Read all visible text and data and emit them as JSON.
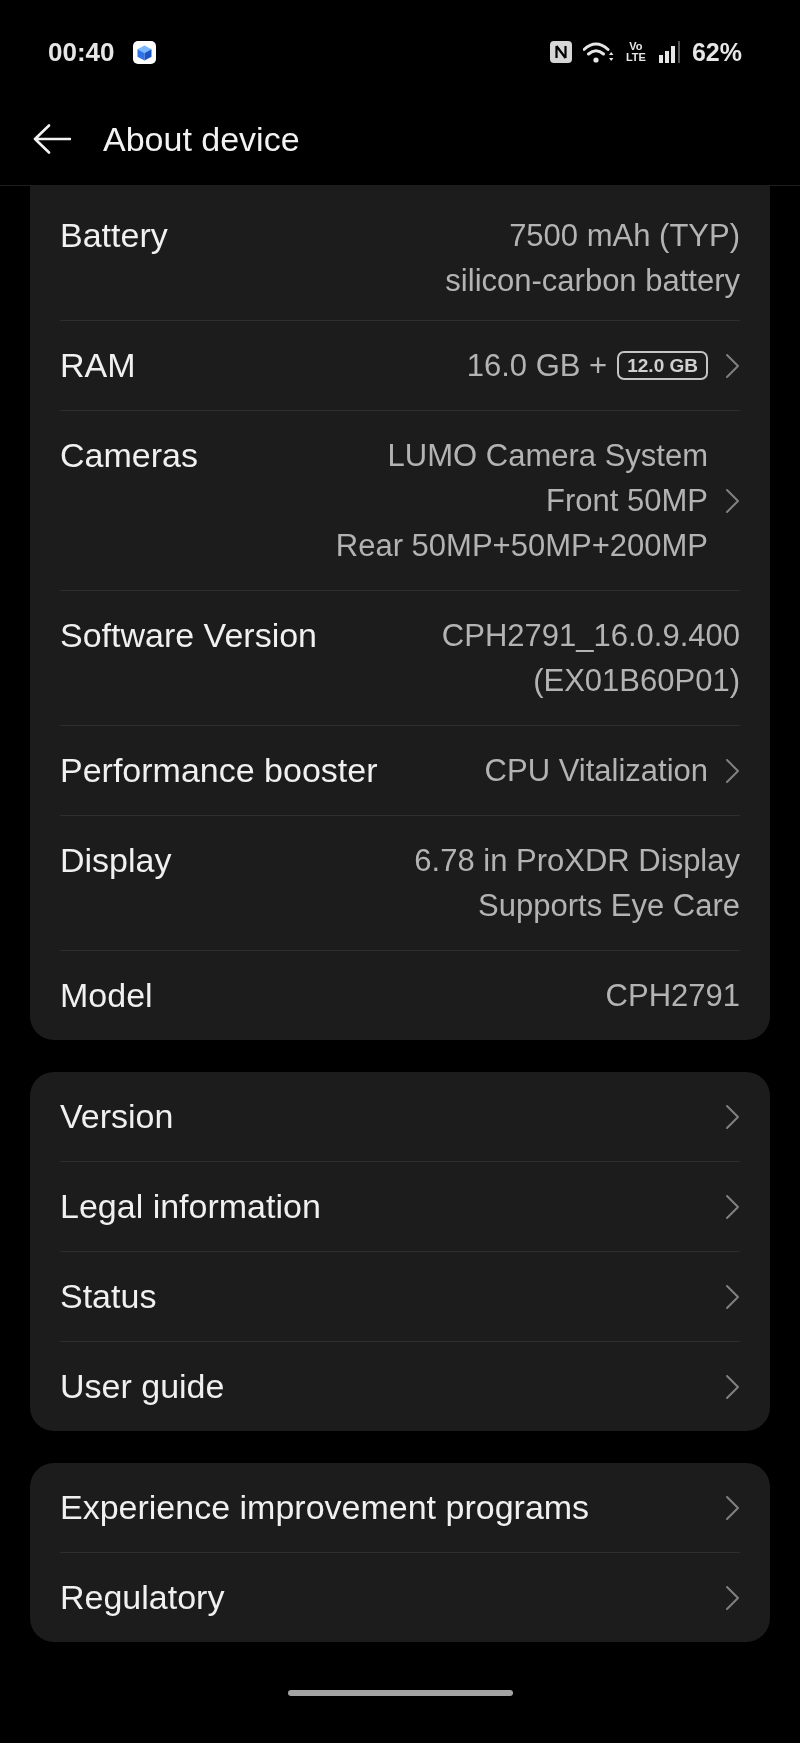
{
  "status_bar": {
    "time": "00:40",
    "network_label": "Vo LTE",
    "battery": "62%"
  },
  "header": {
    "title": "About device"
  },
  "sections": [
    {
      "rows": [
        {
          "label": "Battery",
          "values": [
            "7500 mAh (TYP)",
            "silicon-carbon battery"
          ],
          "chevron": false
        },
        {
          "label": "RAM",
          "values": [
            "16.0 GB +"
          ],
          "badge": "12.0 GB",
          "chevron": true
        },
        {
          "label": "Cameras",
          "values": [
            "LUMO Camera System",
            "Front 50MP",
            "Rear 50MP+50MP+200MP"
          ],
          "chevron": true
        },
        {
          "label": "Software Version",
          "values": [
            "CPH2791_16.0.9.400",
            "(EX01B60P01)"
          ],
          "chevron": false
        },
        {
          "label": "Performance booster",
          "values": [
            "CPU Vitalization"
          ],
          "chevron": true
        },
        {
          "label": "Display",
          "values": [
            "6.78 in ProXDR Display",
            "Supports Eye Care"
          ],
          "chevron": false
        },
        {
          "label": "Model",
          "values": [
            "CPH2791"
          ],
          "chevron": false
        }
      ]
    },
    {
      "rows": [
        {
          "label": "Version",
          "chevron": true
        },
        {
          "label": "Legal information",
          "chevron": true
        },
        {
          "label": "Status",
          "chevron": true
        },
        {
          "label": "User guide",
          "chevron": true
        }
      ]
    },
    {
      "rows": [
        {
          "label": "Experience improvement programs",
          "chevron": true
        },
        {
          "label": "Regulatory",
          "chevron": true
        }
      ]
    }
  ]
}
